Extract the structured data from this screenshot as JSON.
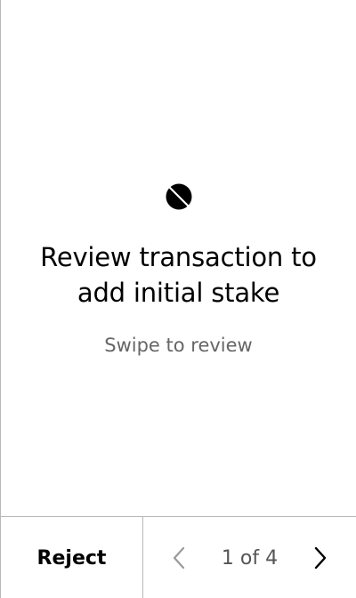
{
  "review": {
    "title": "Review transaction to add initial stake",
    "subtitle": "Swipe to review"
  },
  "footer": {
    "reject_label": "Reject",
    "page_indicator": "1 of 4"
  },
  "icons": {
    "logo": "app-logo-icon",
    "prev": "chevron-left-icon",
    "next": "chevron-right-icon"
  },
  "colors": {
    "text_primary": "#000000",
    "text_secondary": "#666666",
    "disabled": "#9a9a9a",
    "divider": "#b8b8b8"
  }
}
